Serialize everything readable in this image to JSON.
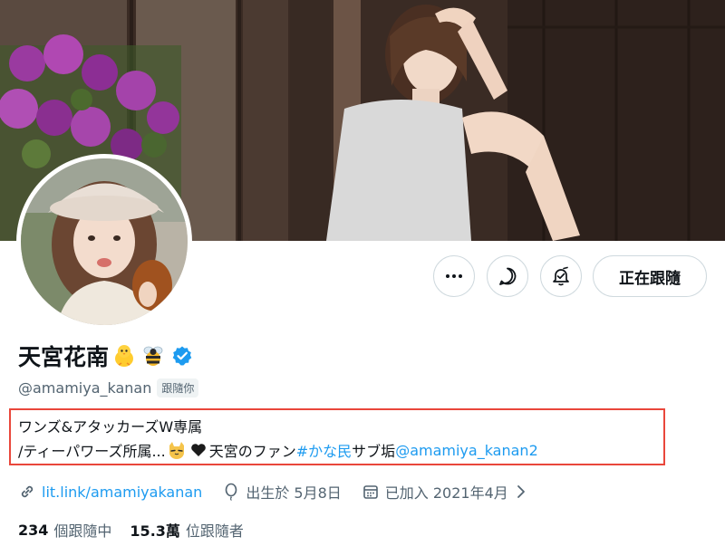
{
  "profile": {
    "display_name": "天宮花南",
    "name_emojis": [
      "chick-emoji",
      "bee-emoji"
    ],
    "verified_icon": "verified-badge-icon",
    "handle": "@amamiya_kanan",
    "follows_you": "跟隨你"
  },
  "actions": {
    "more_icon": "more-icon",
    "message_icon": "message-icon",
    "notify_icon": "notification-bell-icon",
    "following_label": "正在跟隨"
  },
  "bio": {
    "line1": "ワンズ&アタッカーズW専属",
    "line2_prefix": "/ティーパワーズ所属...",
    "line2_middle": " 天宮のファン ",
    "hashtag": "#かな民",
    "line2_suffix": " サブ垢 ",
    "mention": "@amamiya_kanan2"
  },
  "meta": {
    "link": "lit.link/amamiyakanan",
    "birthday": "出生於 5月8日",
    "joined": "已加入 2021年4月"
  },
  "stats": {
    "following_count": "234",
    "following_label": "個跟隨中",
    "followers_count": "15.3萬",
    "followers_label": "位跟隨者"
  },
  "colors": {
    "accent_blue": "#1d9bf0",
    "highlight_border": "#e9473b",
    "muted_text": "#536471"
  }
}
